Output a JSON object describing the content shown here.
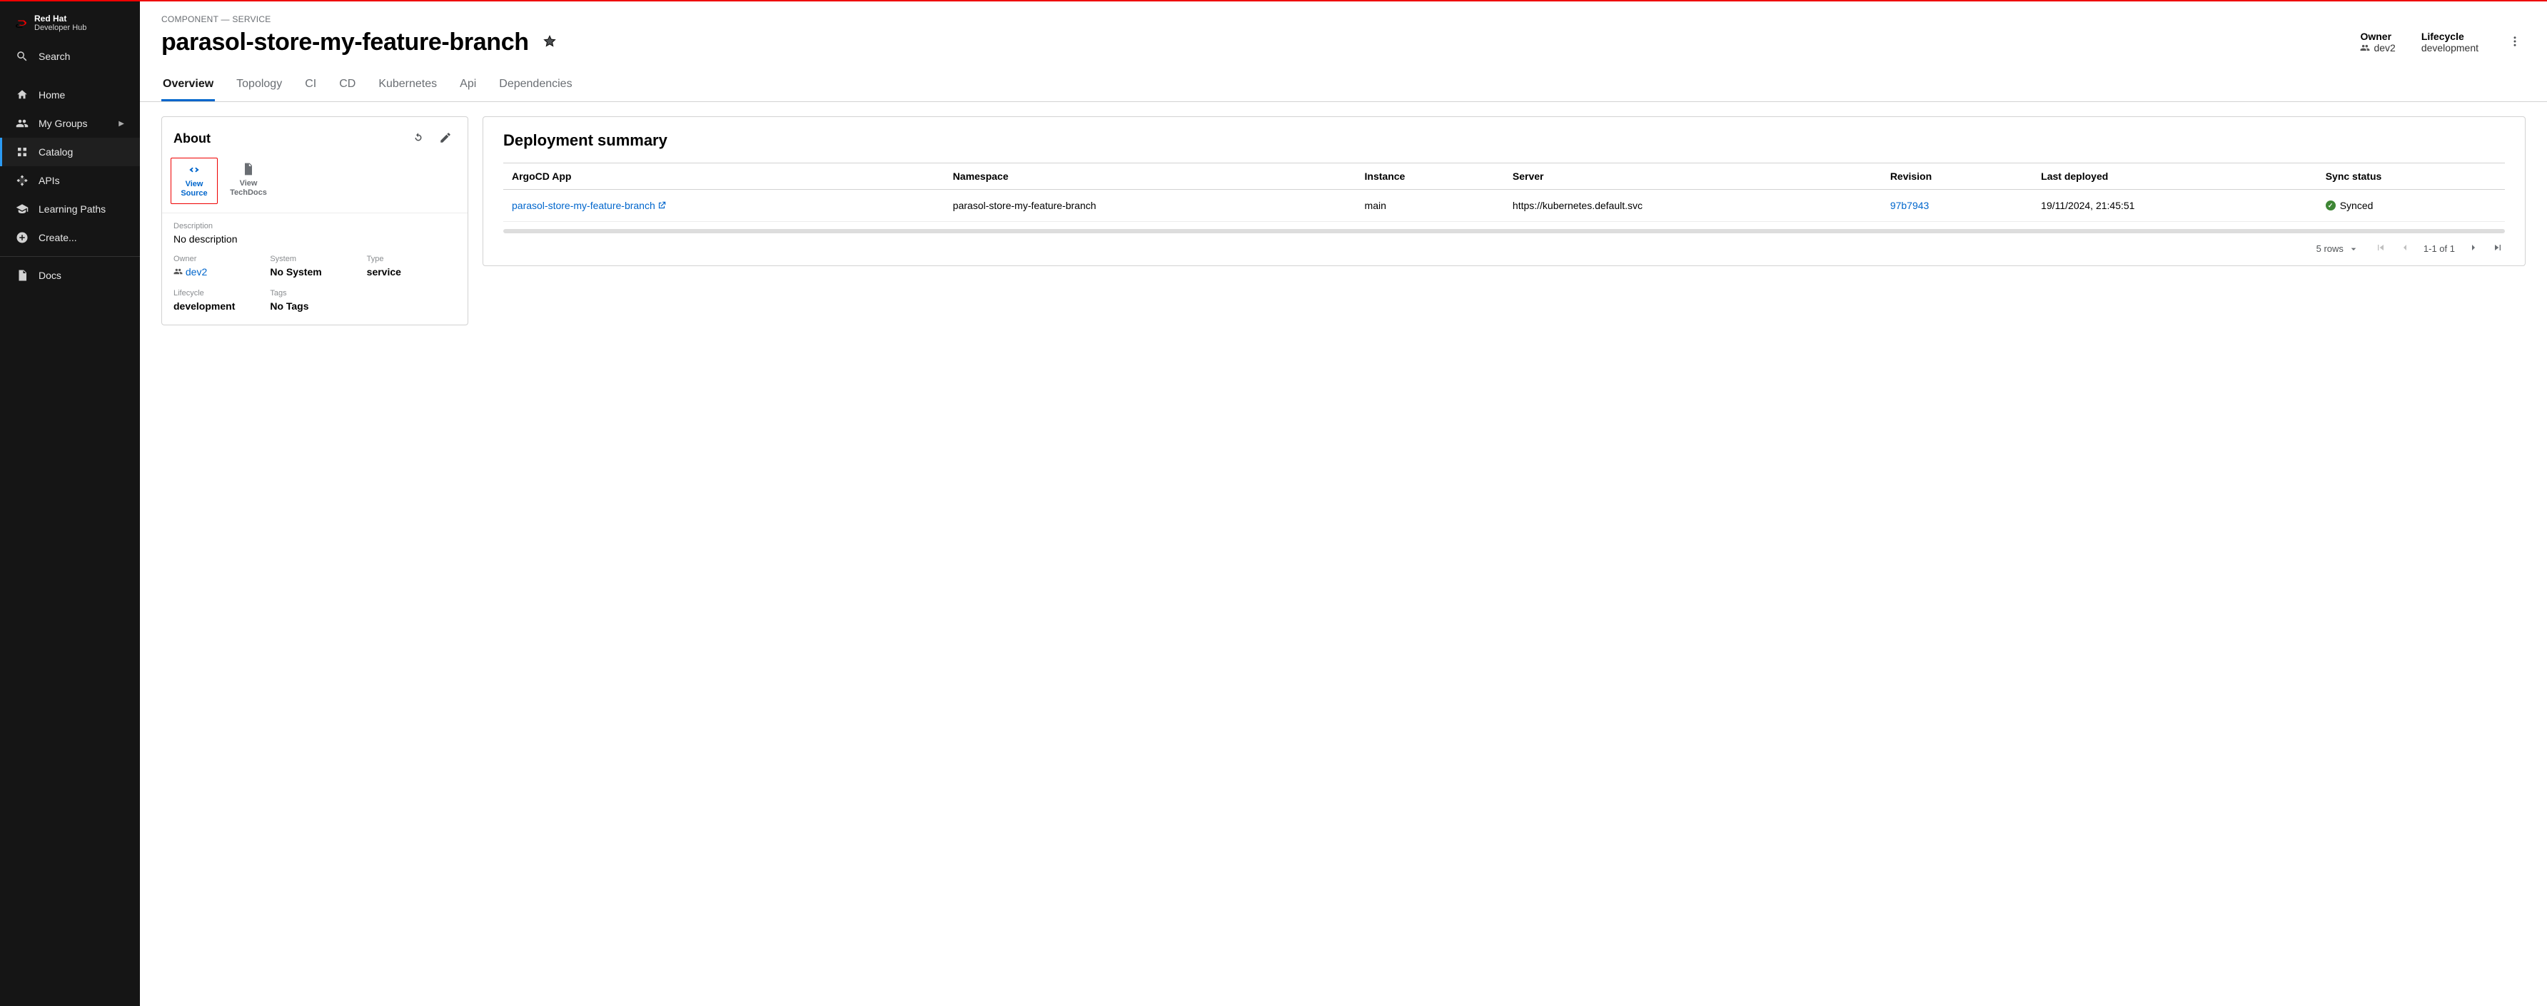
{
  "brand": {
    "top": "Red Hat",
    "bottom": "Developer Hub"
  },
  "sidebar": {
    "search": "Search",
    "items": [
      {
        "label": "Home"
      },
      {
        "label": "My Groups"
      },
      {
        "label": "Catalog"
      },
      {
        "label": "APIs"
      },
      {
        "label": "Learning Paths"
      },
      {
        "label": "Create..."
      }
    ],
    "docs": "Docs"
  },
  "header": {
    "breadcrumb": "COMPONENT — SERVICE",
    "title": "parasol-store-my-feature-branch",
    "owner_label": "Owner",
    "owner_value": "dev2",
    "lifecycle_label": "Lifecycle",
    "lifecycle_value": "development"
  },
  "tabs": [
    "Overview",
    "Topology",
    "CI",
    "CD",
    "Kubernetes",
    "Api",
    "Dependencies"
  ],
  "about": {
    "title": "About",
    "view_source": "View Source",
    "view_techdocs": "View TechDocs",
    "description_label": "Description",
    "description_value": "No description",
    "owner_label": "Owner",
    "owner_value": "dev2",
    "system_label": "System",
    "system_value": "No System",
    "type_label": "Type",
    "type_value": "service",
    "lifecycle_label": "Lifecycle",
    "lifecycle_value": "development",
    "tags_label": "Tags",
    "tags_value": "No Tags"
  },
  "deployment": {
    "title": "Deployment summary",
    "headers": {
      "app": "ArgoCD App",
      "namespace": "Namespace",
      "instance": "Instance",
      "server": "Server",
      "revision": "Revision",
      "last_deployed": "Last deployed",
      "sync_status": "Sync status"
    },
    "rows": [
      {
        "app": "parasol-store-my-feature-branch",
        "namespace": "parasol-store-my-feature-branch",
        "instance": "main",
        "server": "https://kubernetes.default.svc",
        "revision": "97b7943",
        "last_deployed": "19/11/2024, 21:45:51",
        "sync_status": "Synced"
      }
    ],
    "pager": {
      "rows_label": "5 rows",
      "range": "1-1 of 1"
    }
  }
}
